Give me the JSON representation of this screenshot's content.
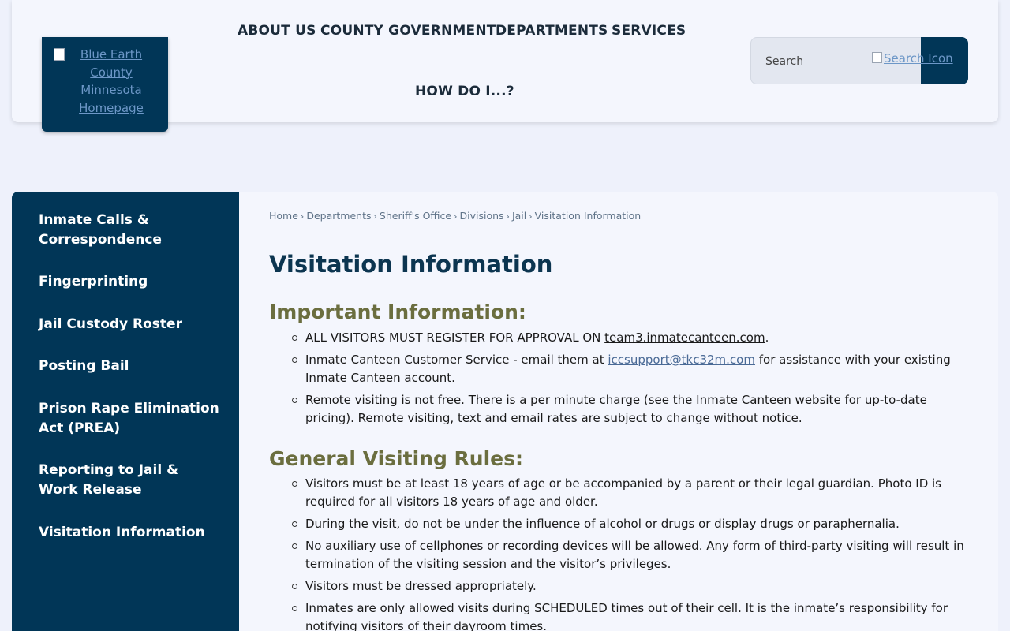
{
  "header": {
    "logo_alt": "Blue Earth County Minnesota Homepage",
    "nav": [
      "ABOUT US",
      "COUNTY GOVERNMENT",
      "DEPARTMENTS",
      "SERVICES",
      "HOW DO I...?"
    ],
    "search": {
      "placeholder": "Search",
      "icon_alt": "Search Icon"
    }
  },
  "sidebar": {
    "items": [
      "Inmate Calls & Correspondence",
      "Fingerprinting",
      "Jail Custody Roster",
      "Posting Bail",
      "Prison Rape Elimination Act (PREA)",
      "Reporting to Jail & Work Release",
      "Visitation Information"
    ]
  },
  "breadcrumb": [
    "Home",
    "Departments",
    "Sheriff's Office",
    "Divisions",
    "Jail",
    "Visitation Information"
  ],
  "main": {
    "title": "Visitation Information",
    "important": {
      "heading": "Important Information:",
      "items": [
        {
          "prefix": "ALL VISITORS MUST REGISTER FOR APPROVAL ON ",
          "link": "team3.inmatecanteen.com",
          "suffix": "."
        },
        {
          "prefix": "Inmate Canteen Customer Service - email them at ",
          "link": "iccsupport@tkc32m.com",
          "suffix": " for assistance with your existing Inmate Canteen account."
        },
        {
          "prefix": "Remote visiting is not free.",
          "link": "",
          "suffix": "  There is a per minute charge (see the Inmate Canteen website for up-to-date pricing).  Remote visiting, text and email rates are subject to change without notice."
        }
      ]
    },
    "general": {
      "heading": "General Visiting Rules:",
      "items": [
        "Visitors must be at least 18 years of age or be accompanied by a parent or their legal guardian. Photo ID is required for all visitors 18 years of age and older.",
        "During the visit, do not be under the influence of alcohol or drugs or display drugs or paraphernalia.",
        "No auxiliary use of cellphones or recording devices will be allowed.  Any form of third-party visiting will result in termination of the visiting session and the visitor’s privileges.",
        "Visitors must be dressed appropriately.",
        "Inmates are only allowed visits during SCHEDULED times out of their cell.  It is the inmate’s responsibility for notifying visitors of their dayroom times."
      ]
    }
  }
}
